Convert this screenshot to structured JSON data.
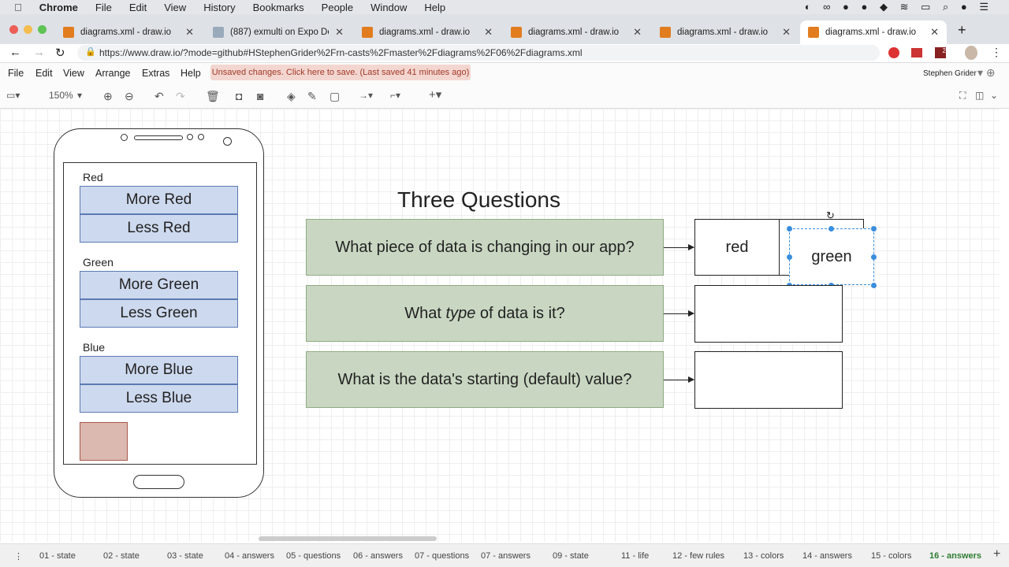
{
  "mac_menu": [
    "Chrome",
    "File",
    "Edit",
    "View",
    "History",
    "Bookmarks",
    "People",
    "Window",
    "Help"
  ],
  "tabs": [
    {
      "label": "diagrams.xml - draw.io"
    },
    {
      "label": "(887) exmulti on Expo Dev"
    },
    {
      "label": "diagrams.xml - draw.io"
    },
    {
      "label": "diagrams.xml - draw.io"
    },
    {
      "label": "diagrams.xml - draw.io"
    },
    {
      "label": "diagrams.xml - draw.io",
      "active": true
    }
  ],
  "url": "https://www.draw.io/?mode=github#HStephenGrider%2Frn-casts%2Fmaster%2Fdiagrams%2F06%2Fdiagrams.xml",
  "extension_badge": "2",
  "app_menu": [
    "File",
    "Edit",
    "View",
    "Arrange",
    "Extras",
    "Help"
  ],
  "unsaved": "Unsaved changes. Click here to save. (Last saved 41 minutes ago)",
  "user": "Stephen Grider",
  "zoom": "150%",
  "diagram": {
    "title": "Three Questions",
    "phone": {
      "sections": [
        {
          "label": "Red",
          "buttons": [
            "More Red",
            "Less Red"
          ]
        },
        {
          "label": "Green",
          "buttons": [
            "More Green",
            "Less Green"
          ]
        },
        {
          "label": "Blue",
          "buttons": [
            "More Blue",
            "Less Blue"
          ]
        }
      ],
      "swatch_color": "#dcb9b0"
    },
    "questions": [
      {
        "pre": "What piece of data is changing in our app?",
        "em": "",
        "post": ""
      },
      {
        "pre": "What ",
        "em": "type",
        "post": " of data is it?"
      },
      {
        "pre": "What is the data's starting (default) value?",
        "em": "",
        "post": ""
      }
    ],
    "answers": [
      "red",
      "green"
    ]
  },
  "pages": [
    "01 - state",
    "02 - state",
    "03 - state",
    "04 - answers",
    "05 - questions",
    "06 - answers",
    "07 - questions",
    "07 - answers",
    "09 - state",
    "11 - life",
    "12 - few rules",
    "13 - colors",
    "14 - answers",
    "15 - colors",
    "16 - answers"
  ],
  "active_page": "16 - answers"
}
